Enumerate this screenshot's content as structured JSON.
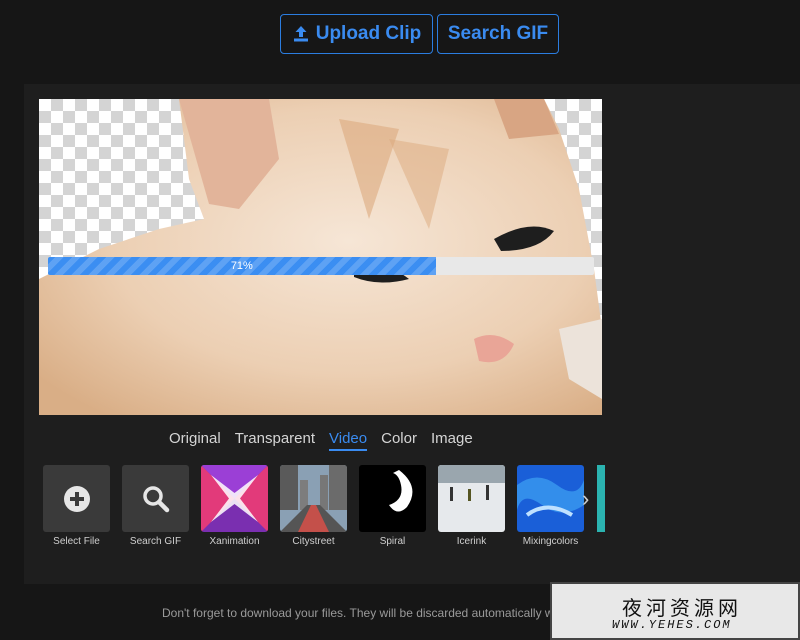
{
  "toolbar": {
    "upload_label": "Upload Clip",
    "search_label": "Search GIF"
  },
  "preview": {
    "progress_label": "71%",
    "progress_fraction": 0.71
  },
  "tabs": [
    {
      "label": "Original",
      "active": false
    },
    {
      "label": "Transparent",
      "active": false
    },
    {
      "label": "Video",
      "active": true
    },
    {
      "label": "Color",
      "active": false
    },
    {
      "label": "Image",
      "active": false
    }
  ],
  "thumbnails": [
    {
      "label": "Select File",
      "icon": "plus-circle-icon"
    },
    {
      "label": "Search GIF",
      "icon": "search-icon"
    },
    {
      "label": "Xanimation"
    },
    {
      "label": "Citystreet"
    },
    {
      "label": "Spiral"
    },
    {
      "label": "Icerink"
    },
    {
      "label": "Mixingcolors"
    }
  ],
  "footer": {
    "text": "Don't forget to download your files. They will be discarded automatically w   you leave the page."
  },
  "watermark": {
    "title": "夜河资源网",
    "url": "WWW.YEHES.COM"
  },
  "colors": {
    "accent": "#3a8bf0",
    "background": "#161616",
    "panel": "#1e1e1e"
  }
}
